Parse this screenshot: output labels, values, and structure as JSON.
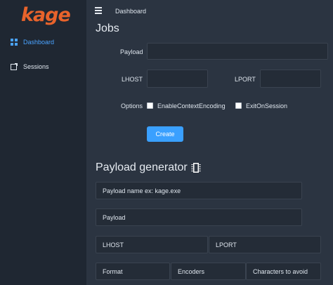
{
  "app": {
    "logo_text": "kage"
  },
  "sidebar": {
    "items": [
      {
        "label": "Dashboard",
        "icon": "grid-icon",
        "active": true
      },
      {
        "label": "Sessions",
        "icon": "external-window-icon",
        "active": false
      }
    ]
  },
  "header": {
    "breadcrumb": "Dashboard"
  },
  "jobs": {
    "title": "Jobs",
    "payload_label": "Payload",
    "lhost_label": "LHOST",
    "lport_label": "LPORT",
    "options_label": "Options",
    "option_1": "EnableContextEncoding",
    "option_2": "ExitOnSession",
    "create_label": "Create"
  },
  "generator": {
    "title": "Payload generator",
    "icon": "memory-chip-icon",
    "payload_name_placeholder": "Payload name ex: kage.exe",
    "payload_placeholder": "Payload",
    "lhost_placeholder": "LHOST",
    "lport_placeholder": "LPORT",
    "format_placeholder": "Format",
    "encoders_placeholder": "Encoders",
    "chars_placeholder": "Characters to avoid"
  },
  "colors": {
    "accent": "#3aa0ff",
    "logo": "#e8632b",
    "sidebar_bg": "#1f2732",
    "main_bg": "#2b3441"
  }
}
